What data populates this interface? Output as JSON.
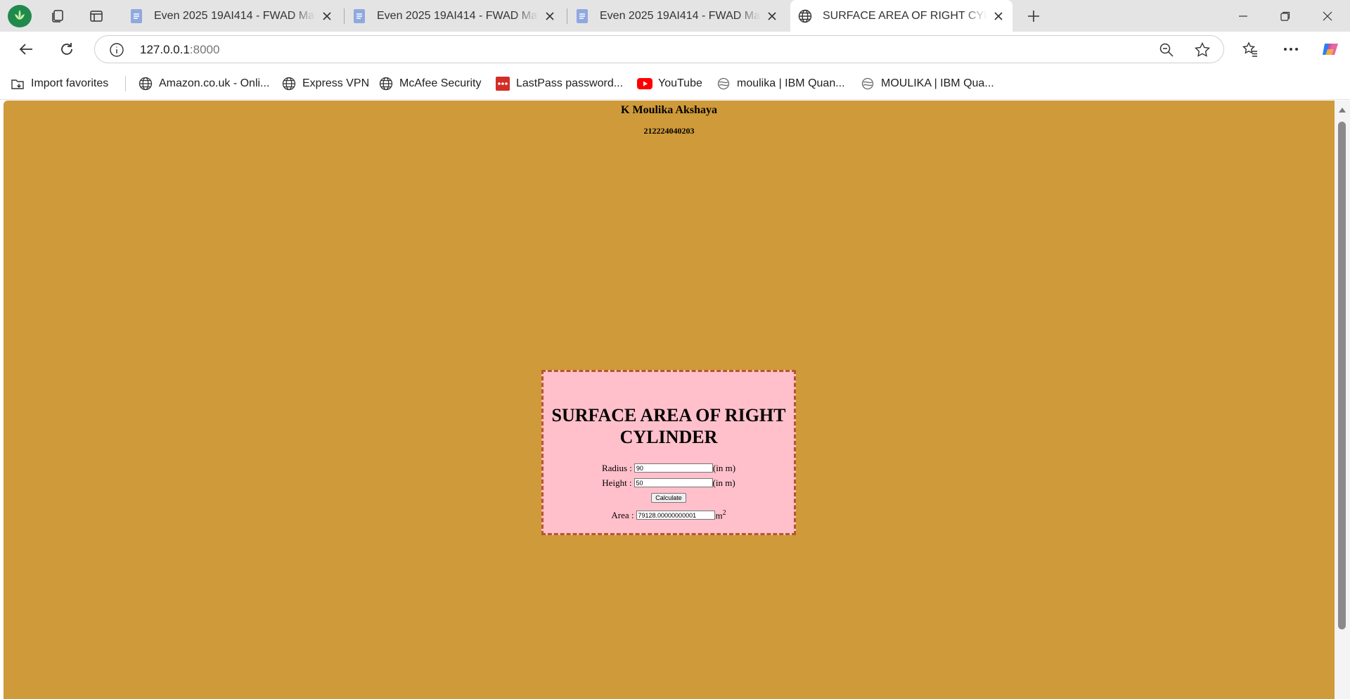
{
  "tabs": [
    {
      "title": "Even 2025 19AI414 - FWAD Materials",
      "active": false
    },
    {
      "title": "Even 2025 19AI414 - FWAD Materials",
      "active": false
    },
    {
      "title": "Even 2025 19AI414 - FWAD Materials",
      "active": false
    },
    {
      "title": "SURFACE AREA OF RIGHT CYLINDER",
      "active": true
    }
  ],
  "address": {
    "host": "127.0.0.1",
    "port": ":8000"
  },
  "bookmarks": [
    {
      "label": "Import favorites",
      "icon": "import-icon"
    },
    {
      "label": "Amazon.co.uk - Onli...",
      "icon": "globe-icon"
    },
    {
      "label": "Express VPN",
      "icon": "globe-icon"
    },
    {
      "label": "McAfee Security",
      "icon": "globe-icon"
    },
    {
      "label": "LastPass password...",
      "icon": "lastpass-icon"
    },
    {
      "label": "YouTube",
      "icon": "youtube-icon"
    },
    {
      "label": "moulika | IBM Quan...",
      "icon": "ibm-quantum-icon"
    },
    {
      "label": "MOULIKA | IBM Qua...",
      "icon": "ibm-quantum-icon"
    }
  ],
  "page": {
    "author_name": "K Moulika Akshaya",
    "register_number": "212224040203",
    "heading": "SURFACE AREA OF RIGHT CYLINDER",
    "radius": {
      "label": "Radius : ",
      "value": "90",
      "unit": "(in m)"
    },
    "height": {
      "label": "Height : ",
      "value": "50",
      "unit": "(in m)"
    },
    "calculate_label": "Calculate",
    "area": {
      "label": "Area : ",
      "value": "79128.00000000001",
      "unit": "m",
      "exponent": "2"
    }
  },
  "colors": {
    "page_background": "#cf9a39",
    "card_background": "#ffc0cb",
    "card_border": "#b5582a"
  }
}
